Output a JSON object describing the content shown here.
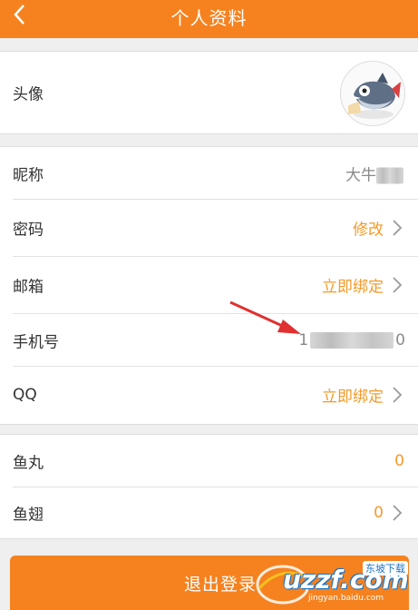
{
  "header": {
    "title": "个人资料"
  },
  "avatar_row": {
    "label": "头像"
  },
  "nickname_row": {
    "label": "昵称",
    "value": "大牛"
  },
  "password_row": {
    "label": "密码",
    "value": "修改"
  },
  "email_row": {
    "label": "邮箱",
    "value": "立即绑定"
  },
  "phone_row": {
    "label": "手机号",
    "value_start": "1",
    "value_end": "0"
  },
  "qq_row": {
    "label": "QQ",
    "value": "立即绑定"
  },
  "fishball_row": {
    "label": "鱼丸",
    "value": "0"
  },
  "fishwing_row": {
    "label": "鱼翅",
    "value": "0"
  },
  "logout": {
    "label": "退出登录"
  },
  "watermark": {
    "brand": "uzzf.com",
    "tag": "东坡下载",
    "site": "jingyan.baidu.com"
  },
  "colors": {
    "accent": "#f5821f",
    "link": "#f39a2a",
    "annotation_arrow": "#e03030"
  }
}
